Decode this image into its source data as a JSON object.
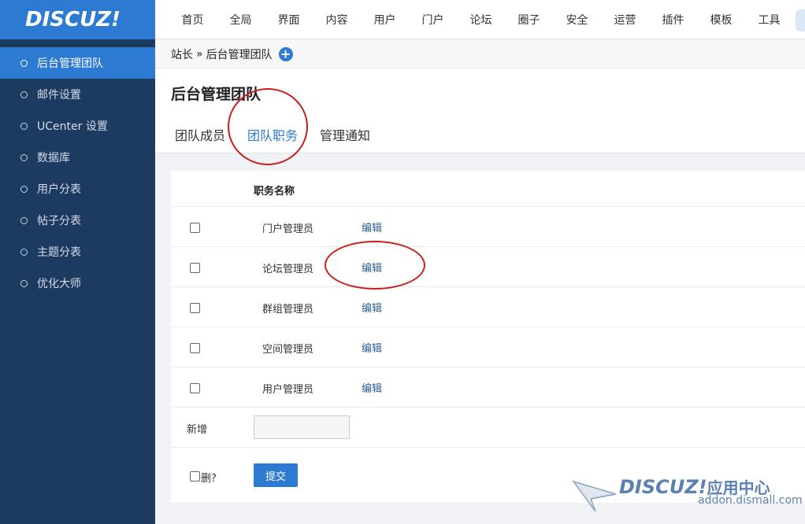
{
  "logo": "DISCUZ!",
  "sidebar": {
    "items": [
      {
        "label": "后台管理团队"
      },
      {
        "label": "邮件设置"
      },
      {
        "label": "UCenter 设置"
      },
      {
        "label": "数据库"
      },
      {
        "label": "用户分表"
      },
      {
        "label": "帖子分表"
      },
      {
        "label": "主题分表"
      },
      {
        "label": "优化大师"
      }
    ],
    "active_index": 0
  },
  "topnav": {
    "items": [
      "首页",
      "全局",
      "界面",
      "内容",
      "用户",
      "门户",
      "论坛",
      "圈子",
      "安全",
      "运营",
      "插件",
      "模板",
      "工具"
    ]
  },
  "breadcrumb": {
    "root": "站长",
    "separator": "»",
    "current": "后台管理团队",
    "add_icon": "plus-icon"
  },
  "page": {
    "title": "后台管理团队",
    "tabs": [
      {
        "label": "团队成员"
      },
      {
        "label": "团队职务"
      },
      {
        "label": "管理通知"
      }
    ],
    "active_tab": 1
  },
  "table": {
    "column_header": "职务名称",
    "rows": [
      {
        "name": "门户管理员",
        "action": "编辑"
      },
      {
        "name": "论坛管理员",
        "action": "编辑"
      },
      {
        "name": "群组管理员",
        "action": "编辑"
      },
      {
        "name": "空间管理员",
        "action": "编辑"
      },
      {
        "name": "用户管理员",
        "action": "编辑"
      }
    ],
    "new_label": "新增",
    "new_value": "",
    "delete_label": "删?",
    "submit_label": "提交"
  },
  "watermark": {
    "brand": "DISCUZ!",
    "suffix": "应用中心",
    "url": "addon.dismall.com"
  },
  "colors": {
    "accent": "#2c7ad1",
    "sidebar_bg": "#1d3a61",
    "annotation_red": "#cc1c1c"
  }
}
